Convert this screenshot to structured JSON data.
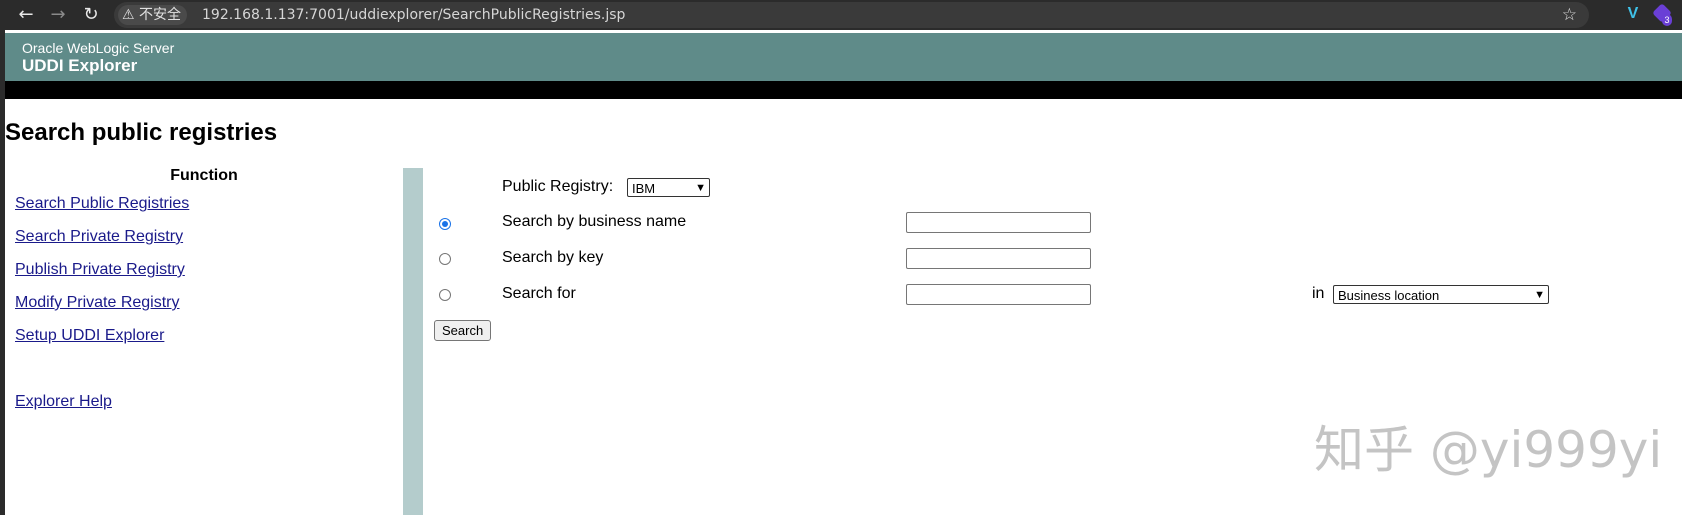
{
  "browser": {
    "security_label": "不安全",
    "url": "192.168.1.137:7001/uddiexplorer/SearchPublicRegistries.jsp",
    "extension_badge": "3"
  },
  "banner": {
    "subtitle": "Oracle WebLogic Server",
    "title": "UDDI Explorer"
  },
  "page": {
    "heading": "Search public registries"
  },
  "menu": {
    "heading": "Function",
    "items": [
      {
        "label": "Search Public Registries"
      },
      {
        "label": "Search Private Registry"
      },
      {
        "label": "Publish Private Registry"
      },
      {
        "label": "Modify Private Registry"
      },
      {
        "label": "Setup UDDI Explorer"
      },
      {
        "label": "Explorer Help"
      }
    ]
  },
  "form": {
    "registry_label": "Public Registry:",
    "registry_value": "IBM",
    "options": [
      {
        "label": "Search by business name",
        "selected": true,
        "value": ""
      },
      {
        "label": "Search by key",
        "selected": false,
        "value": ""
      },
      {
        "label": "Search for",
        "selected": false,
        "value": ""
      }
    ],
    "in_label": "in",
    "in_value": "Business location",
    "search_button": "Search"
  },
  "watermark": "知乎 @yi999yi",
  "colors": {
    "banner": "#5f8b89",
    "divider": "#b4cccc",
    "link": "#1a1a8a",
    "radio_accent": "#1a73e8"
  }
}
